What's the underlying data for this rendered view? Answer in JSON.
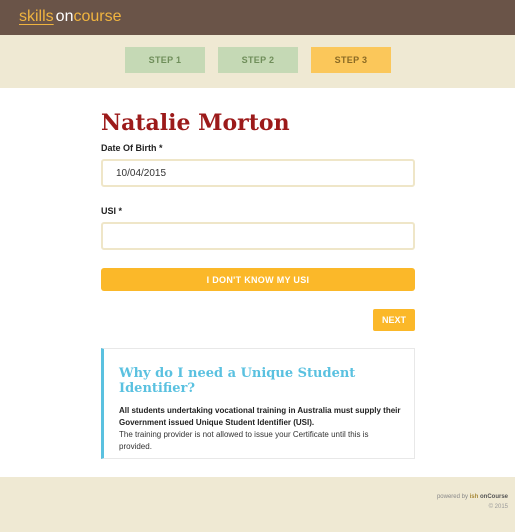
{
  "header": {
    "logo": {
      "part1": "skills",
      "part2": "on",
      "part3": "course"
    }
  },
  "steps": [
    {
      "label": "STEP 1",
      "state": "done"
    },
    {
      "label": "STEP 2",
      "state": "done"
    },
    {
      "label": "STEP 3",
      "state": "active"
    }
  ],
  "form": {
    "student_name": "Natalie Morton",
    "dob_label": "Date Of Birth *",
    "dob_value": "10/04/2015",
    "usi_label": "USI *",
    "usi_value": "",
    "unknown_usi_button": "I DON'T KNOW MY USI",
    "next_button": "NEXT"
  },
  "info": {
    "title": "Why do I need a Unique Student Identifier?",
    "bold_text": "All students undertaking vocational training in Australia must supply their Government issued Unique Student Identifier (USI).",
    "body_text": "The training provider is not allowed to issue your Certificate until this is provided."
  },
  "footer": {
    "powered_prefix": "powered by",
    "powered_brand": "ish",
    "powered_product": "onCourse",
    "copyright": "© 2015"
  },
  "colors": {
    "header_bg": "#6a5448",
    "brand_orange": "#f0b43f",
    "steps_bg": "#efe9d3",
    "step_done": "#c5d9b5",
    "step_active": "#fbc75a",
    "name_red": "#9c1a1a",
    "button_yellow": "#fbb829",
    "info_blue": "#5ac1e0"
  }
}
